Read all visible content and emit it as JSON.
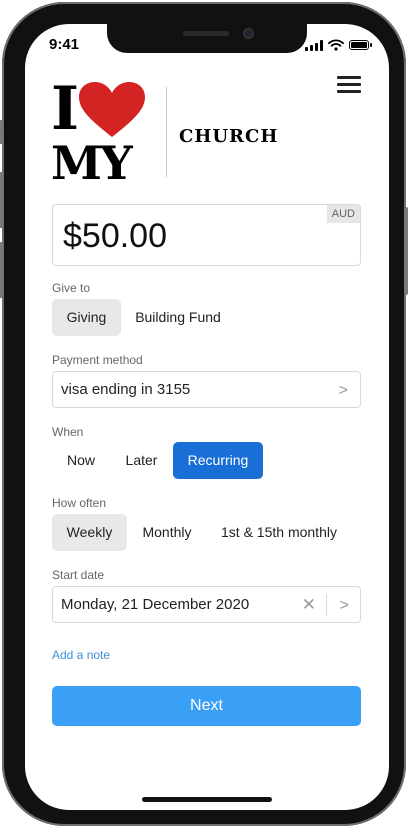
{
  "status_bar": {
    "time": "9:41"
  },
  "logo": {
    "line1": "I",
    "line2": "MY",
    "heart_color": "#d42323"
  },
  "header": {
    "church_name": "CHURCH"
  },
  "amount": {
    "value": "$50.00",
    "currency": "AUD"
  },
  "give_to": {
    "label": "Give to",
    "options": [
      "Giving",
      "Building Fund"
    ],
    "selected": "Giving"
  },
  "payment": {
    "label": "Payment method",
    "value": "visa ending in 3155"
  },
  "when": {
    "label": "When",
    "options": [
      "Now",
      "Later",
      "Recurring"
    ],
    "selected": "Recurring"
  },
  "how_often": {
    "label": "How often",
    "options": [
      "Weekly",
      "Monthly",
      "1st & 15th monthly"
    ],
    "selected": "Weekly"
  },
  "start_date": {
    "label": "Start date",
    "value": "Monday, 21 December 2020"
  },
  "note_link": "Add a note",
  "next_button": "Next",
  "colors": {
    "accent": "#1a6fd6",
    "next_button": "#3aa0f6",
    "link": "#3d8fdc"
  }
}
